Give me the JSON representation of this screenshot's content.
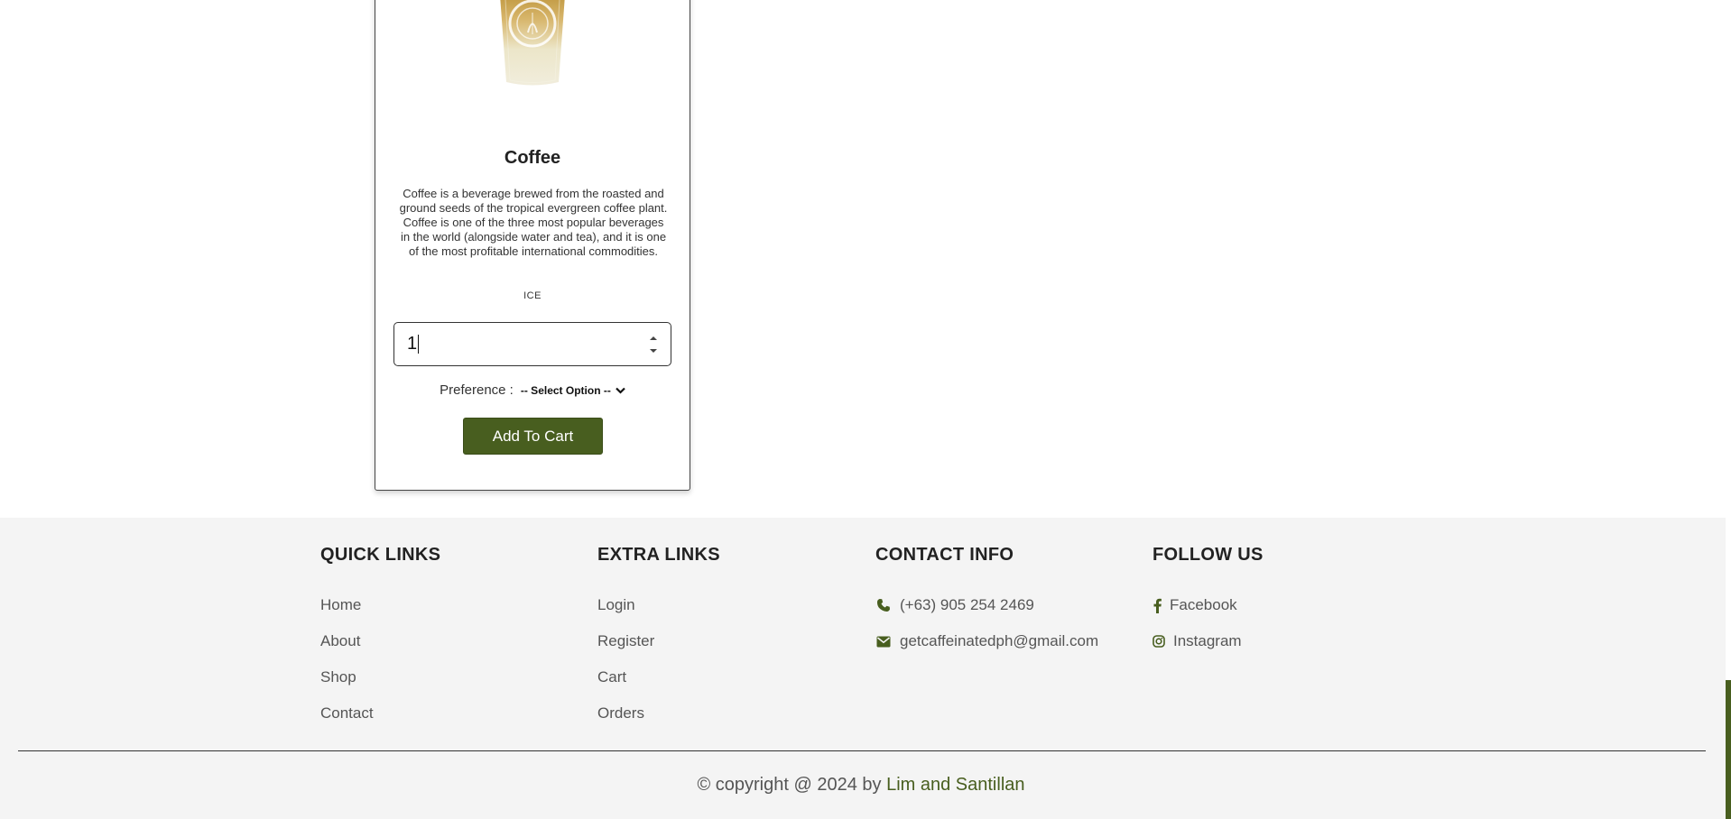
{
  "product": {
    "title": "Coffee",
    "description": "Coffee is a beverage brewed from the roasted and ground seeds of the tropical evergreen coffee plant. Coffee is one of the three most popular beverages in the world (alongside water and tea), and it is one of the most profitable international commodities.",
    "tag": "ICE",
    "quantity": "1",
    "preference_label": "Preference :",
    "preference_selected": "-- Select Option --",
    "add_to_cart_label": "Add To Cart"
  },
  "footer": {
    "quick_links": {
      "title": "QUICK LINKS",
      "items": [
        "Home",
        "About",
        "Shop",
        "Contact"
      ]
    },
    "extra_links": {
      "title": "EXTRA LINKS",
      "items": [
        "Login",
        "Register",
        "Cart",
        "Orders"
      ]
    },
    "contact_info": {
      "title": "CONTACT INFO",
      "phone": "(+63) 905 254 2469",
      "email": "getcaffeinatedph@gmail.com"
    },
    "follow_us": {
      "title": "FOLLOW US",
      "facebook": "Facebook",
      "instagram": "Instagram"
    },
    "copyright_prefix": "© copyright @ 2024 by ",
    "copyright_authors": "Lim and Santillan"
  },
  "colors": {
    "accent": "#485e1f",
    "footer_bg": "#f4f4f4",
    "card_border": "#444444"
  },
  "icons": [
    "chevron-down-icon",
    "phone-icon",
    "envelope-icon",
    "facebook-icon",
    "instagram-icon"
  ]
}
